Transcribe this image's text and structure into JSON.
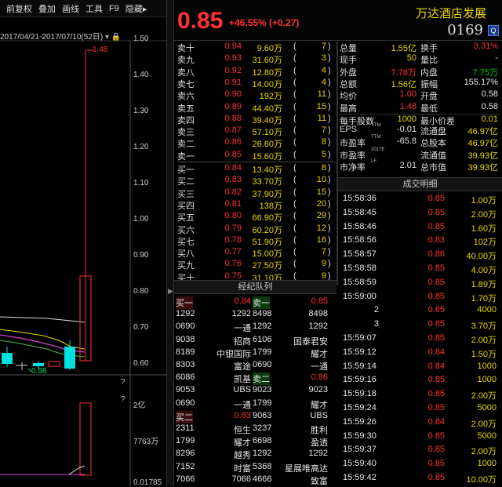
{
  "toolbar": {
    "items": [
      "前复权",
      "叠加",
      "画线",
      "工具",
      "F9",
      "隐藏▸"
    ]
  },
  "chart": {
    "date_range": "2017/04/21-2017/07/10(52日)",
    "high_marker": "1.48",
    "low_marker": "0.58",
    "price_axis": [
      "1.50",
      "1.40",
      "1.30",
      "1.20",
      "1.10",
      "1.00",
      "0.90",
      "0.80",
      "0.70",
      "0.60"
    ],
    "vol_axis": [
      "2亿",
      "7763万",
      "0.01785"
    ],
    "question": "?"
  },
  "quote": {
    "price": "0.85",
    "change": "+46.55% (+0.27)",
    "name": "万达酒店发展",
    "code": "0169",
    "code_icon": "Q"
  },
  "asks": [
    [
      "卖十",
      "0.94",
      "9.60万",
      "7"
    ],
    [
      "卖九",
      "0.93",
      "31.60万",
      "3"
    ],
    [
      "卖八",
      "0.92",
      "12.80万",
      "4"
    ],
    [
      "卖七",
      "0.91",
      "14.00万",
      "4"
    ],
    [
      "卖六",
      "0.90",
      "192万",
      "11"
    ],
    [
      "卖五",
      "0.89",
      "44.40万",
      "15"
    ],
    [
      "卖四",
      "0.88",
      "39.40万",
      "11"
    ],
    [
      "卖三",
      "0.87",
      "57.10万",
      "7"
    ],
    [
      "卖二",
      "0.86",
      "26.60万",
      "8"
    ],
    [
      "卖一",
      "0.85",
      "15.60万",
      "5"
    ]
  ],
  "bids": [
    [
      "买一",
      "0.84",
      "13.40万",
      "8"
    ],
    [
      "买二",
      "0.83",
      "33.70万",
      "10"
    ],
    [
      "买三",
      "0.82",
      "37.90万",
      "15"
    ],
    [
      "买四",
      "0.81",
      "138万",
      "20"
    ],
    [
      "买五",
      "0.80",
      "66.90万",
      "29"
    ],
    [
      "买六",
      "0.79",
      "60.20万",
      "12"
    ],
    [
      "买七",
      "0.78",
      "51.90万",
      "16"
    ],
    [
      "买八",
      "0.77",
      "15.00万",
      "7"
    ],
    [
      "买九",
      "0.76",
      "27.50万",
      "9"
    ],
    [
      "买十",
      "0.75",
      "31.10万",
      "9"
    ]
  ],
  "stats": [
    [
      "总量",
      "1.55亿",
      "换手",
      "3.31%"
    ],
    [
      "现手",
      "50",
      "量比",
      "-"
    ],
    [
      "外盘",
      "7.78万",
      "内盘",
      "7.75万"
    ],
    [
      "总额",
      "1.56亿",
      "振幅",
      "155.17%"
    ],
    [
      "均价",
      "1.00",
      "开盘",
      "0.58"
    ],
    [
      "最高",
      "1.48",
      "最低",
      "0.58"
    ]
  ],
  "lot": [
    "每手股数",
    "1000",
    "最小价差",
    "0.01"
  ],
  "fund": [
    [
      "EPS",
      "TTM",
      "-0.01",
      "流通盘",
      "46.97亿"
    ],
    [
      "市盈率",
      "TTM",
      "-65.8",
      "总股本",
      "46.97亿"
    ],
    [
      "市盈率",
      "2017E",
      "",
      "流通值",
      "39.93亿"
    ],
    [
      "市净率",
      "LF",
      "2.01",
      "总市值",
      "39.93亿"
    ]
  ],
  "trades_title": "成交明细",
  "trades": [
    [
      "15:58:36",
      "0.85",
      "1.00万"
    ],
    [
      "15:58:45",
      "0.85",
      "2.00万"
    ],
    [
      "15:58:46",
      "0.85",
      "1.60万"
    ],
    [
      "15:58:56",
      "0.83",
      "102万"
    ],
    [
      "15:58:57",
      "0.86",
      "40.00万"
    ],
    [
      "15:58:58",
      "0.85",
      "4.00万"
    ],
    [
      "15:58:59",
      "0.85",
      "1.89万"
    ],
    [
      "15:59:00",
      "0.85",
      "1.70万"
    ],
    [
      "2",
      "0.85",
      "4000"
    ],
    [
      "3",
      "0.85",
      "3.70万"
    ],
    [
      "15:59:07",
      "0.85",
      "2.00万"
    ],
    [
      "15:59:12",
      "0.84",
      "1.50万"
    ],
    [
      "15:59:14",
      "0.84",
      "1000"
    ],
    [
      "15:59:16",
      "0.85",
      "1000"
    ],
    [
      "15:59:18",
      "0.85",
      "2.00万"
    ],
    [
      "15:59:24",
      "0.85",
      "5000"
    ],
    [
      "15:59:26",
      "0.84",
      "2.00万"
    ],
    [
      "15:59:30",
      "0.85",
      "5000"
    ],
    [
      "15:59:37",
      "0.85",
      "2.00万"
    ],
    [
      "15:59:40",
      "0.85",
      "1000"
    ],
    [
      "15:59:42",
      "0.85",
      "10.00万"
    ]
  ],
  "broker_title": "经纪队列",
  "broker": [
    [
      "买一",
      "0.84",
      "卖一",
      "0.85"
    ],
    [
      "1292",
      "1292",
      "8498",
      "8498"
    ],
    [
      "0690",
      "一通",
      "1292",
      "1292"
    ],
    [
      "9038",
      "招商",
      "6106",
      "国泰君安"
    ],
    [
      "8189",
      "中银国际",
      "1799",
      "耀才"
    ],
    [
      "8303",
      "富途",
      "0690",
      "一通"
    ],
    [
      "6086",
      "凯基",
      "卖二",
      "0.86"
    ],
    [
      "9053",
      "UBS",
      "9023",
      "9023"
    ],
    [
      "0690",
      "一通",
      "1799",
      "耀才"
    ],
    [
      "买二",
      "0.83",
      "9063",
      "UBS"
    ],
    [
      "2311",
      "恒生",
      "3237",
      "胜利"
    ],
    [
      "1799",
      "耀才",
      "6698",
      "盈透"
    ],
    [
      "8296",
      "越秀",
      "1292",
      "1292"
    ],
    [
      "7152",
      "时富",
      "5368",
      "星展唯高达"
    ],
    [
      "7066",
      "7066",
      "4666",
      "致富"
    ]
  ]
}
